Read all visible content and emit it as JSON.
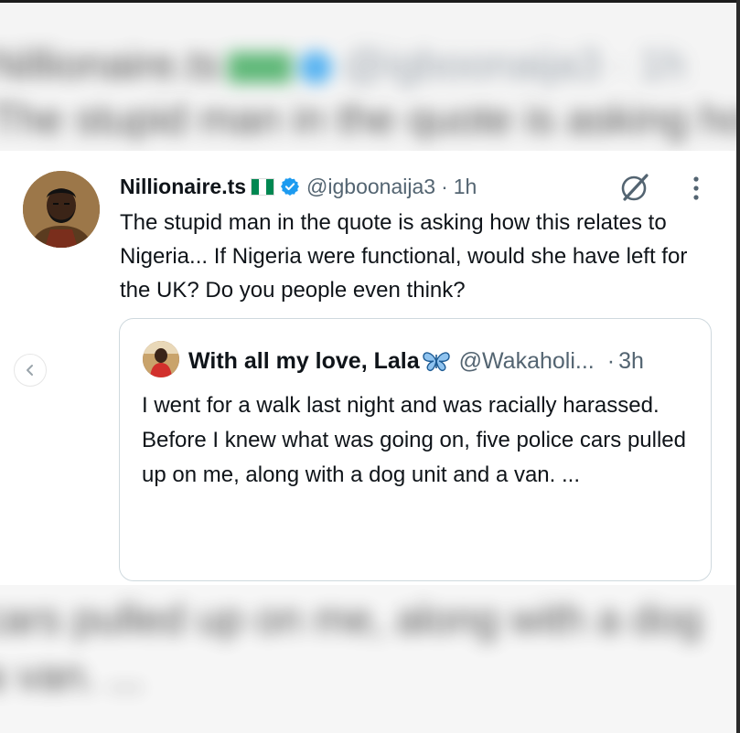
{
  "tweet": {
    "display_name": "Nillionaire.ts",
    "handle": "@igboonaija3",
    "separator": "·",
    "time": "1h",
    "text": "The stupid man in the quote is asking how this relates to Nigeria... If Nigeria were functional, would she have left for the UK? Do you people even think?",
    "flag_icon": "nigeria-flag-icon",
    "verified_color": "#1d9bf0"
  },
  "quoted_tweet": {
    "display_name": "With all my love, Lala",
    "handle": "@Wakaholi...",
    "separator": "·",
    "time": "3h",
    "text_lines": [
      "I went for a walk last night and was racially harassed.",
      "Before I knew what was going on, five police cars pulled up on me, along with a dog unit and a van. ..."
    ]
  },
  "blurred_background": {
    "top_line_1": "Nillionaire.ts",
    "top_line_1_handle": "@igboonaija3 · 1h",
    "top_line_2": "The stupid man in the quote is asking how",
    "bottom_line_1": "cars pulled up on me, along with a dog",
    "bottom_line_2": "a van. ..."
  },
  "colors": {
    "text": "#0f1419",
    "secondary": "#536471",
    "border": "#cfd9de"
  }
}
